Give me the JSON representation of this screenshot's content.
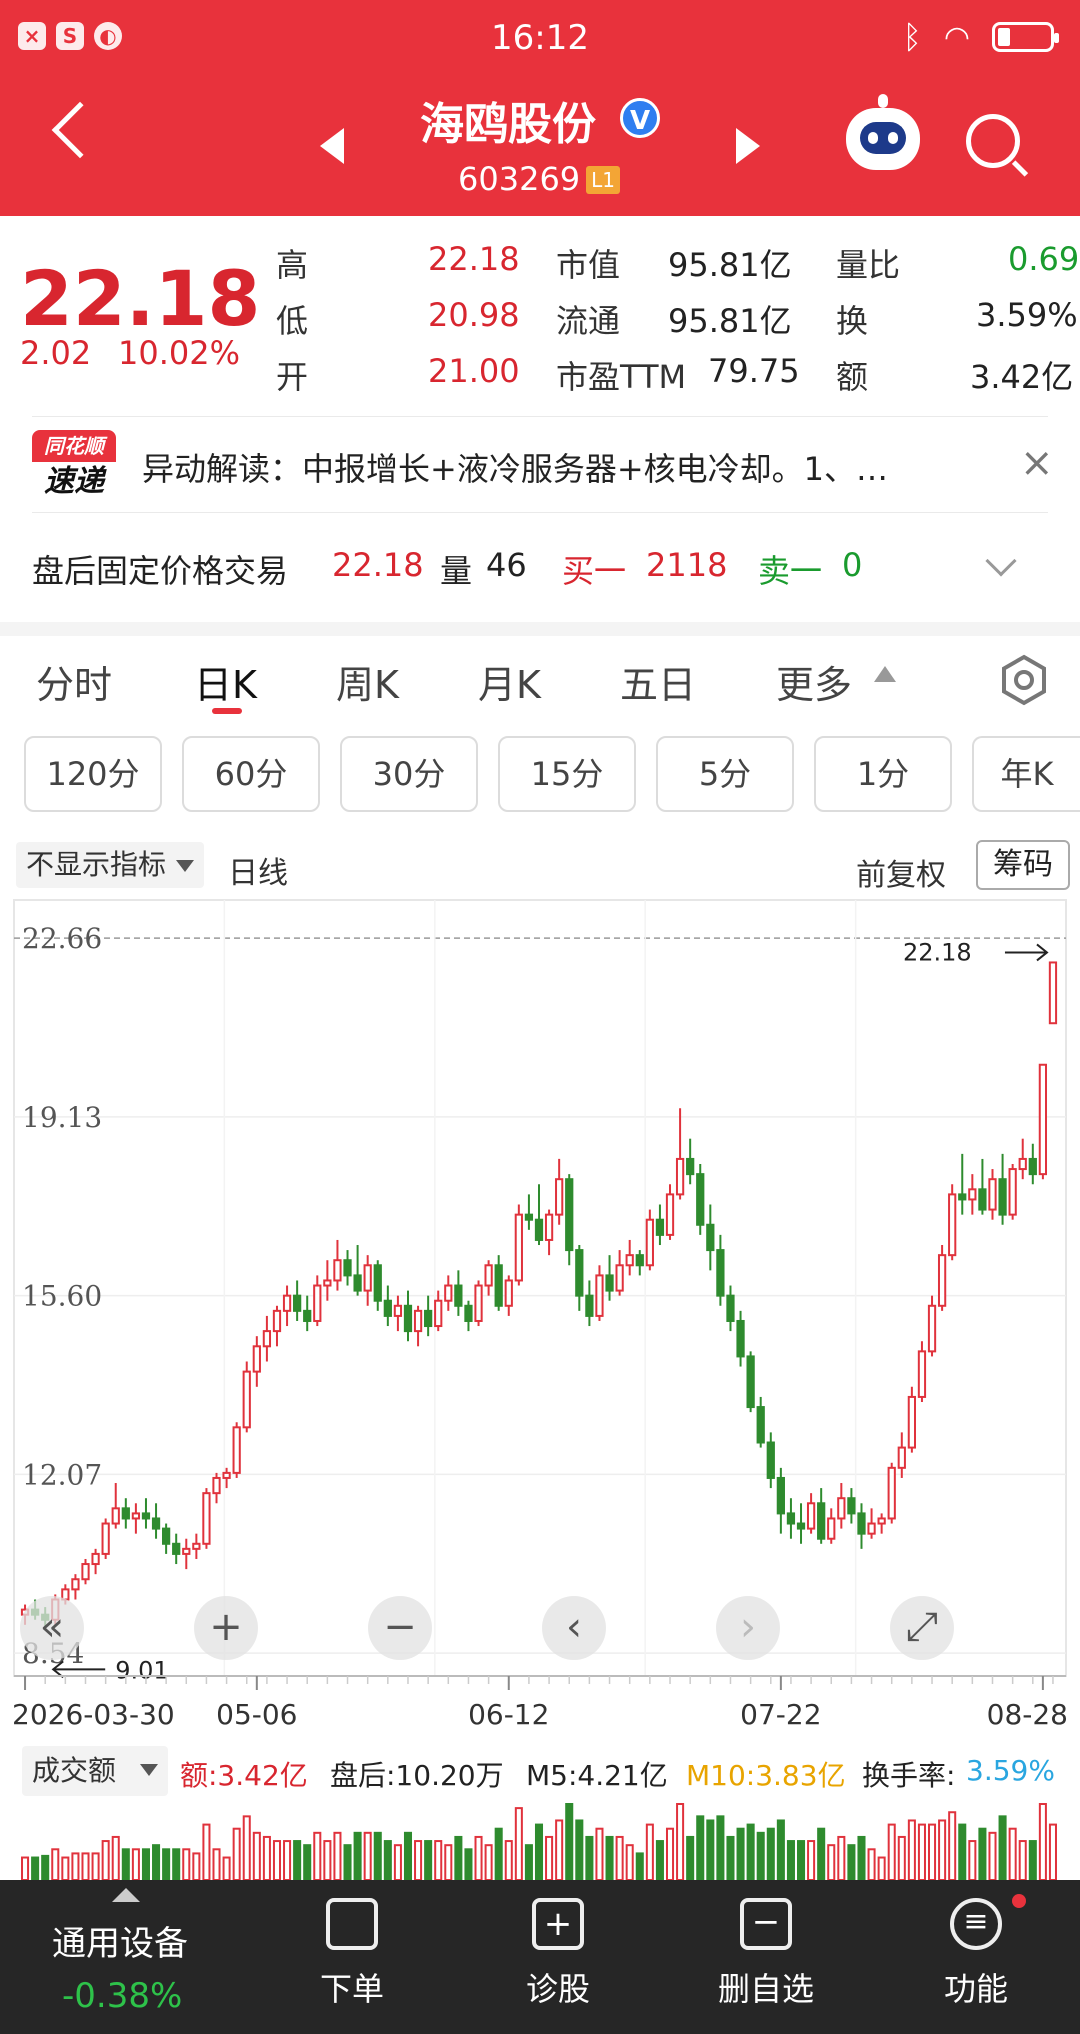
{
  "status_bar": {
    "time": "16:12",
    "left_icons": [
      "×",
      "S",
      "◐"
    ]
  },
  "header": {
    "stock_name": "海鸥股份",
    "verified": "V",
    "stock_code": "603269",
    "level_badge": "L1"
  },
  "quote": {
    "price": "22.18",
    "change": "2.02",
    "change_pct": "10.02%",
    "grid": [
      {
        "label": "高",
        "value": "22.18",
        "label2": "市值",
        "value2": "95.81亿",
        "label3": "量比",
        "value3": "0.69"
      },
      {
        "label": "低",
        "value": "20.98",
        "label2": "流通",
        "value2": "95.81亿",
        "label3": "换",
        "value3": "3.59%"
      },
      {
        "label": "开",
        "value": "21.00",
        "label2": "市盈TTM",
        "value2": "79.75",
        "label3": "额",
        "value3": "3.42亿"
      }
    ]
  },
  "news": {
    "logo_top": "同花顺",
    "logo_bottom": "速递",
    "text": "异动解读：中报增长+液冷服务器+核电冷却。1、…",
    "close": "×"
  },
  "after_hours": {
    "label": "盘后固定价格交易",
    "price": "22.18",
    "vol_label": "量",
    "vol": "46",
    "bid_label": "买一",
    "bid": "2118",
    "ask_label": "卖一",
    "ask": "0"
  },
  "tabs": [
    "分时",
    "日K",
    "周K",
    "月K",
    "五日",
    "更多"
  ],
  "active_tab": "日K",
  "periods": [
    "120分",
    "60分",
    "30分",
    "15分",
    "5分",
    "1分",
    "年K"
  ],
  "chart_header": {
    "indicator": "不显示指标",
    "line_type": "日线",
    "adjust": "前复权",
    "chips": "筹码"
  },
  "chart_data": {
    "type": "candlestick",
    "ylim": [
      8.8,
      22.9
    ],
    "y_ticks": [
      "22.66",
      "19.13",
      "15.60",
      "12.07",
      "8.54"
    ],
    "y_tick_values": [
      22.66,
      19.13,
      15.6,
      12.07,
      8.54
    ],
    "x_ticks": [
      "2026-03-30",
      "05-06",
      "06-12",
      "07-22",
      "08-28"
    ],
    "x_tick_index": [
      0,
      23,
      48,
      75,
      101
    ],
    "max_label": "22.18",
    "min_label": "9.01",
    "up_color": "#e0323c",
    "down_color": "#2e8b2e",
    "candles": [
      [
        9.3,
        9.5,
        9.1,
        9.4
      ],
      [
        9.4,
        9.6,
        9.2,
        9.3
      ],
      [
        9.3,
        9.45,
        9.01,
        9.2
      ],
      [
        9.2,
        9.7,
        9.1,
        9.6
      ],
      [
        9.6,
        9.9,
        9.5,
        9.8
      ],
      [
        9.8,
        10.1,
        9.6,
        10.0
      ],
      [
        10.0,
        10.4,
        9.9,
        10.3
      ],
      [
        10.3,
        10.6,
        10.1,
        10.5
      ],
      [
        10.5,
        11.2,
        10.4,
        11.1
      ],
      [
        11.1,
        11.9,
        11.0,
        11.4
      ],
      [
        11.4,
        11.6,
        11.0,
        11.2
      ],
      [
        11.2,
        11.5,
        10.9,
        11.3
      ],
      [
        11.3,
        11.6,
        11.0,
        11.2
      ],
      [
        11.2,
        11.5,
        10.8,
        11.0
      ],
      [
        11.0,
        11.1,
        10.5,
        10.7
      ],
      [
        10.7,
        10.9,
        10.3,
        10.5
      ],
      [
        10.5,
        10.8,
        10.2,
        10.6
      ],
      [
        10.6,
        10.9,
        10.4,
        10.7
      ],
      [
        10.7,
        11.8,
        10.6,
        11.7
      ],
      [
        11.7,
        12.1,
        11.5,
        12.0
      ],
      [
        12.0,
        12.2,
        11.8,
        12.1
      ],
      [
        12.1,
        13.1,
        12.0,
        13.0
      ],
      [
        13.0,
        14.3,
        12.9,
        14.1
      ],
      [
        14.1,
        14.8,
        13.8,
        14.6
      ],
      [
        14.6,
        15.2,
        14.3,
        14.9
      ],
      [
        14.9,
        15.4,
        14.6,
        15.3
      ],
      [
        15.3,
        15.8,
        15.0,
        15.6
      ],
      [
        15.6,
        15.9,
        15.1,
        15.3
      ],
      [
        15.3,
        15.6,
        14.9,
        15.1
      ],
      [
        15.1,
        16.0,
        15.0,
        15.8
      ],
      [
        15.8,
        16.3,
        15.5,
        15.9
      ],
      [
        15.9,
        16.7,
        15.7,
        16.3
      ],
      [
        16.3,
        16.5,
        15.8,
        16.0
      ],
      [
        16.0,
        16.6,
        15.6,
        15.7
      ],
      [
        15.7,
        16.4,
        15.4,
        16.2
      ],
      [
        16.2,
        16.3,
        15.3,
        15.5
      ],
      [
        15.5,
        15.8,
        15.0,
        15.2
      ],
      [
        15.2,
        15.6,
        14.9,
        15.4
      ],
      [
        15.4,
        15.7,
        14.7,
        14.9
      ],
      [
        14.9,
        15.4,
        14.6,
        15.3
      ],
      [
        15.3,
        15.6,
        14.8,
        15.0
      ],
      [
        15.0,
        15.7,
        14.9,
        15.5
      ],
      [
        15.5,
        16.0,
        15.3,
        15.8
      ],
      [
        15.8,
        16.1,
        15.2,
        15.4
      ],
      [
        15.4,
        15.5,
        14.9,
        15.1
      ],
      [
        15.1,
        15.9,
        15.0,
        15.8
      ],
      [
        15.8,
        16.3,
        15.6,
        16.2
      ],
      [
        16.2,
        16.4,
        15.3,
        15.4
      ],
      [
        15.4,
        16.0,
        15.2,
        15.9
      ],
      [
        15.9,
        17.4,
        15.8,
        17.2
      ],
      [
        17.2,
        17.6,
        16.9,
        17.1
      ],
      [
        17.1,
        17.8,
        16.6,
        16.7
      ],
      [
        16.7,
        17.3,
        16.4,
        17.2
      ],
      [
        17.2,
        18.3,
        17.0,
        17.9
      ],
      [
        17.9,
        18.0,
        16.2,
        16.5
      ],
      [
        16.5,
        16.6,
        15.3,
        15.6
      ],
      [
        15.6,
        15.9,
        15.0,
        15.2
      ],
      [
        15.2,
        16.2,
        15.1,
        16.0
      ],
      [
        16.0,
        16.4,
        15.5,
        15.7
      ],
      [
        15.7,
        16.5,
        15.6,
        16.2
      ],
      [
        16.2,
        16.7,
        16.0,
        16.4
      ],
      [
        16.4,
        16.5,
        16.0,
        16.2
      ],
      [
        16.2,
        17.3,
        16.1,
        17.1
      ],
      [
        17.1,
        17.4,
        16.6,
        16.8
      ],
      [
        16.8,
        17.8,
        16.7,
        17.6
      ],
      [
        17.6,
        19.3,
        17.5,
        18.3
      ],
      [
        18.3,
        18.7,
        17.8,
        18.0
      ],
      [
        18.0,
        18.2,
        16.8,
        17.0
      ],
      [
        17.0,
        17.4,
        16.1,
        16.5
      ],
      [
        16.5,
        16.8,
        15.4,
        15.6
      ],
      [
        15.6,
        15.8,
        14.9,
        15.1
      ],
      [
        15.1,
        15.3,
        14.2,
        14.4
      ],
      [
        14.4,
        14.5,
        13.3,
        13.4
      ],
      [
        13.4,
        13.6,
        12.6,
        12.7
      ],
      [
        12.7,
        12.9,
        11.8,
        12.0
      ],
      [
        12.0,
        12.2,
        10.9,
        11.3
      ],
      [
        11.3,
        11.6,
        10.8,
        11.1
      ],
      [
        11.1,
        11.5,
        10.7,
        11.0
      ],
      [
        11.0,
        11.7,
        10.9,
        11.5
      ],
      [
        11.5,
        11.8,
        10.7,
        10.8
      ],
      [
        10.8,
        11.4,
        10.7,
        11.2
      ],
      [
        11.2,
        11.9,
        11.0,
        11.6
      ],
      [
        11.6,
        11.8,
        11.1,
        11.3
      ],
      [
        11.3,
        11.5,
        10.6,
        10.9
      ],
      [
        10.9,
        11.4,
        10.8,
        11.1
      ],
      [
        11.1,
        11.3,
        10.9,
        11.2
      ],
      [
        11.2,
        12.3,
        11.1,
        12.2
      ],
      [
        12.2,
        12.9,
        12.0,
        12.6
      ],
      [
        12.6,
        13.8,
        12.5,
        13.6
      ],
      [
        13.6,
        14.7,
        13.5,
        14.5
      ],
      [
        14.5,
        15.6,
        14.4,
        15.4
      ],
      [
        15.4,
        16.6,
        15.3,
        16.4
      ],
      [
        16.4,
        17.8,
        16.3,
        17.6
      ],
      [
        17.6,
        18.4,
        17.2,
        17.5
      ],
      [
        17.5,
        18.0,
        17.2,
        17.7
      ],
      [
        17.7,
        18.3,
        17.2,
        17.3
      ],
      [
        17.3,
        18.1,
        17.1,
        17.9
      ],
      [
        17.9,
        18.4,
        17.0,
        17.2
      ],
      [
        17.2,
        18.2,
        17.1,
        18.1
      ],
      [
        18.1,
        18.7,
        17.9,
        18.3
      ],
      [
        18.3,
        18.6,
        17.8,
        18.0
      ],
      [
        18.0,
        20.16,
        17.9,
        20.16
      ],
      [
        20.98,
        22.18,
        20.98,
        22.18
      ]
    ]
  },
  "chart_controls": [
    "«",
    "+",
    "−",
    "‹",
    "›",
    "⤢"
  ],
  "volume": {
    "selector": "成交额",
    "amount_label": "额:3.42亿",
    "after_label": "盘后:10.20万",
    "m5_label": "M5:4.21亿",
    "m10_label": "M10:3.83亿",
    "turnover_label": "换手率:",
    "turnover_value": "3.59%",
    "colors": {
      "amount": "#d8262f",
      "m5": "#222222",
      "m10": "#e8a400",
      "turnover": "#2aa6e0"
    }
  },
  "bottom_bar": {
    "sector_name": "通用设备",
    "sector_change": "-0.38%",
    "items": [
      {
        "label": "下单",
        "icon": "order-icon"
      },
      {
        "label": "诊股",
        "icon": "diagnose-icon"
      },
      {
        "label": "删自选",
        "icon": "remove-watch-icon"
      },
      {
        "label": "功能",
        "icon": "menu-icon"
      }
    ]
  }
}
